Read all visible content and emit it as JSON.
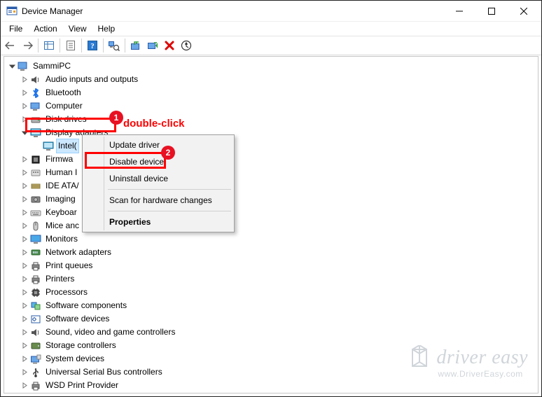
{
  "title": "Device Manager",
  "menu": [
    "File",
    "Action",
    "View",
    "Help"
  ],
  "root_name": "SammiPC",
  "categories": [
    {
      "label": "Audio inputs and outputs",
      "icon": "speaker",
      "expanded": false
    },
    {
      "label": "Bluetooth",
      "icon": "bluetooth",
      "expanded": false
    },
    {
      "label": "Computer",
      "icon": "computer",
      "expanded": false
    },
    {
      "label": "Disk drives",
      "icon": "disk",
      "expanded": false
    },
    {
      "label": "Display adapters",
      "icon": "display",
      "expanded": true,
      "highlight": 1,
      "children": [
        {
          "label": "Intel(",
          "icon": "display",
          "selected": true
        }
      ]
    },
    {
      "label": "Firmwa",
      "icon": "firmware",
      "expanded": false,
      "cut": true
    },
    {
      "label": "Human I",
      "icon": "hid",
      "expanded": false,
      "cut": true
    },
    {
      "label": "IDE ATA/",
      "icon": "ide",
      "expanded": false,
      "cut": true
    },
    {
      "label": "Imaging",
      "icon": "imaging",
      "expanded": false,
      "cut": true
    },
    {
      "label": "Keyboar",
      "icon": "keyboard",
      "expanded": false,
      "cut": true
    },
    {
      "label": "Mice anc",
      "icon": "mouse",
      "expanded": false,
      "cut": true
    },
    {
      "label": "Monitors",
      "icon": "monitor",
      "expanded": false
    },
    {
      "label": "Network adapters",
      "icon": "network",
      "expanded": false
    },
    {
      "label": "Print queues",
      "icon": "printer",
      "expanded": false
    },
    {
      "label": "Printers",
      "icon": "printer",
      "expanded": false
    },
    {
      "label": "Processors",
      "icon": "cpu",
      "expanded": false
    },
    {
      "label": "Software components",
      "icon": "swcomp",
      "expanded": false
    },
    {
      "label": "Software devices",
      "icon": "swdev",
      "expanded": false
    },
    {
      "label": "Sound, video and game controllers",
      "icon": "speaker",
      "expanded": false
    },
    {
      "label": "Storage controllers",
      "icon": "storage",
      "expanded": false
    },
    {
      "label": "System devices",
      "icon": "system",
      "expanded": false
    },
    {
      "label": "Universal Serial Bus controllers",
      "icon": "usb",
      "expanded": false
    },
    {
      "label": "WSD Print Provider",
      "icon": "printer",
      "expanded": false
    }
  ],
  "context_menu": {
    "items": [
      {
        "label": "Update driver"
      },
      {
        "label": "Disable device",
        "highlight": 2
      },
      {
        "label": "Uninstall device"
      },
      {
        "sep": true
      },
      {
        "label": "Scan for hardware changes"
      },
      {
        "sep": true
      },
      {
        "label": "Properties",
        "bold": true
      }
    ]
  },
  "annotations": {
    "hint1": "double-click",
    "badge1": "1",
    "badge2": "2"
  },
  "watermark": {
    "line1": "driver easy",
    "line2": "www.DriverEasy.com"
  }
}
